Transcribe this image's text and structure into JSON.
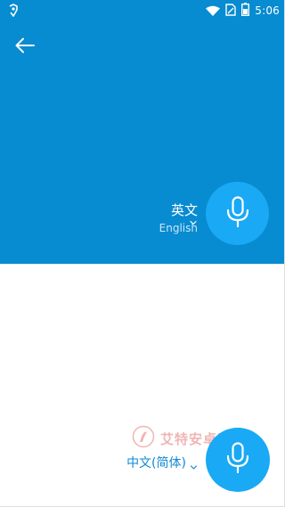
{
  "status_bar": {
    "time": "5:06",
    "icons": [
      "app-notification-icon",
      "wifi-icon",
      "sim-icon",
      "battery-icon"
    ]
  },
  "header": {
    "back_icon": "arrow-left-icon"
  },
  "source_language": {
    "name": "英文",
    "subtitle": "English"
  },
  "target_language": {
    "name": "中文(简体)"
  },
  "watermark": {
    "text": "艾特安卓网"
  },
  "colors": {
    "primary": "#078bd1",
    "mic_button": "#19a9f5",
    "target_text": "#1189d3",
    "background": "#ffffff"
  }
}
